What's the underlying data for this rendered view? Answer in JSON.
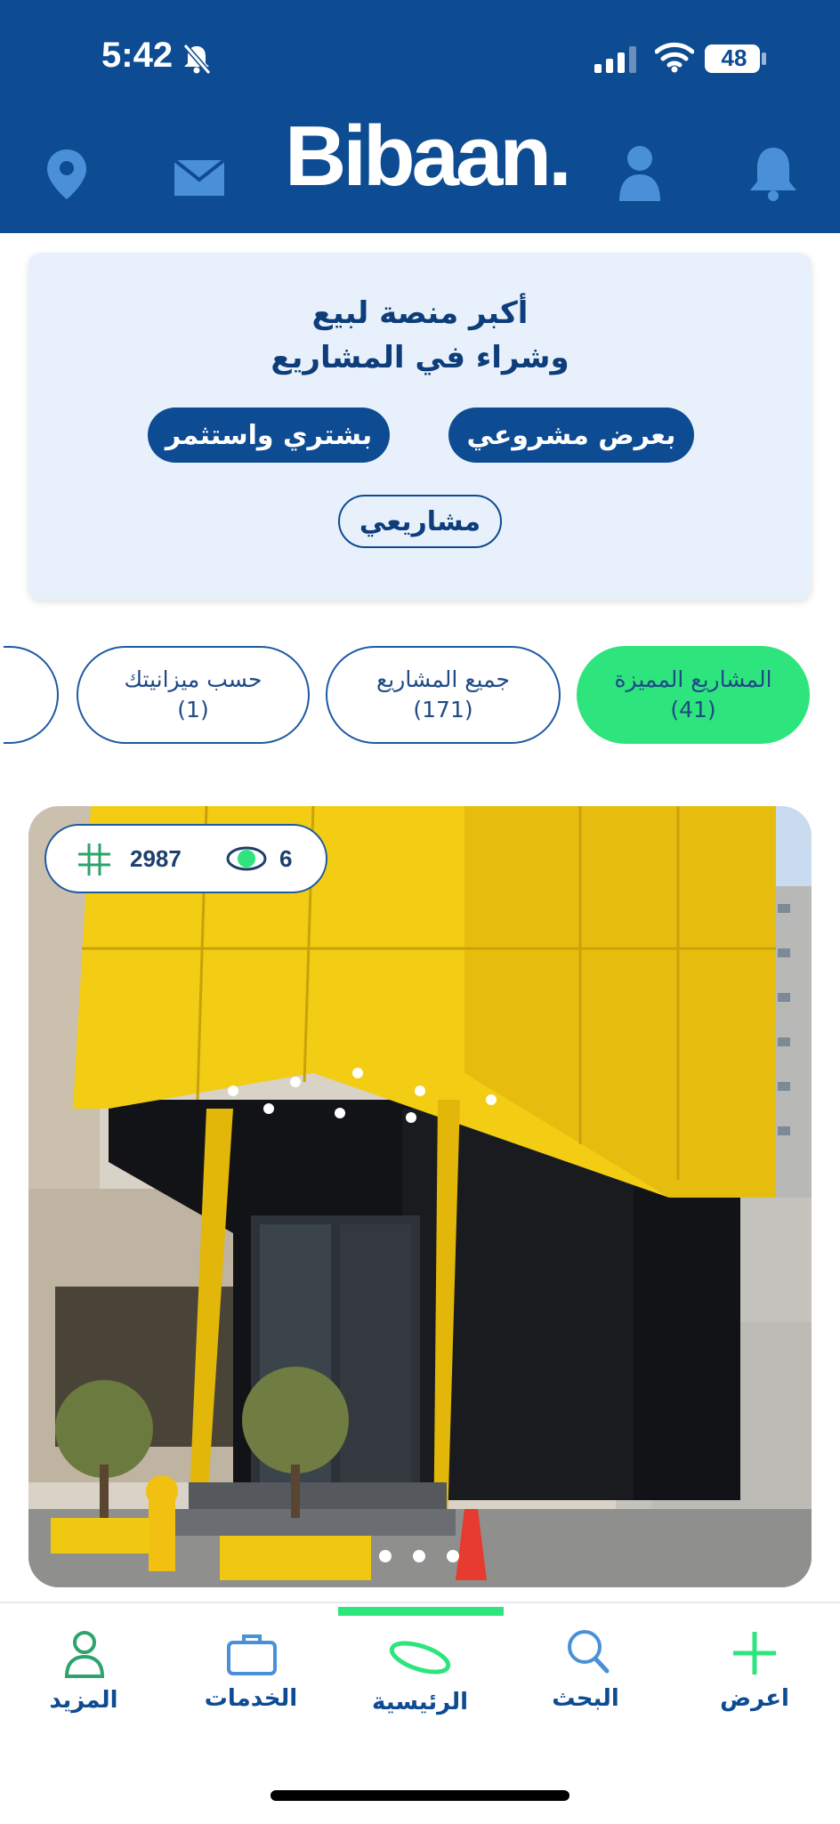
{
  "status_bar": {
    "time": "5:42",
    "battery": "48"
  },
  "header": {
    "logo": "Bibaan."
  },
  "hero": {
    "line1": "أكبر منصة لبيع",
    "line2": "وشراء في المشاريع",
    "sell_button": "بعرض مشروعي",
    "buy_button": "بشتري واستثمر",
    "my_projects_button": "مشاريعي"
  },
  "filters": [
    {
      "label": "المشاريع المميزة",
      "count": "(41)"
    },
    {
      "label": "جميع المشاريع",
      "count": "(171)"
    },
    {
      "label": "حسب ميزانيتك",
      "count": "(1)"
    }
  ],
  "listing": {
    "id": "2987",
    "views": "6"
  },
  "tabbar": {
    "add": "اعرض",
    "search": "البحث",
    "home": "الرئيسية",
    "services": "الخدمات",
    "more": "المزيد"
  },
  "colors": {
    "brand_blue": "#0d4b92",
    "accent_green": "#2ee57d",
    "hero_bg": "#e8f1fb"
  }
}
